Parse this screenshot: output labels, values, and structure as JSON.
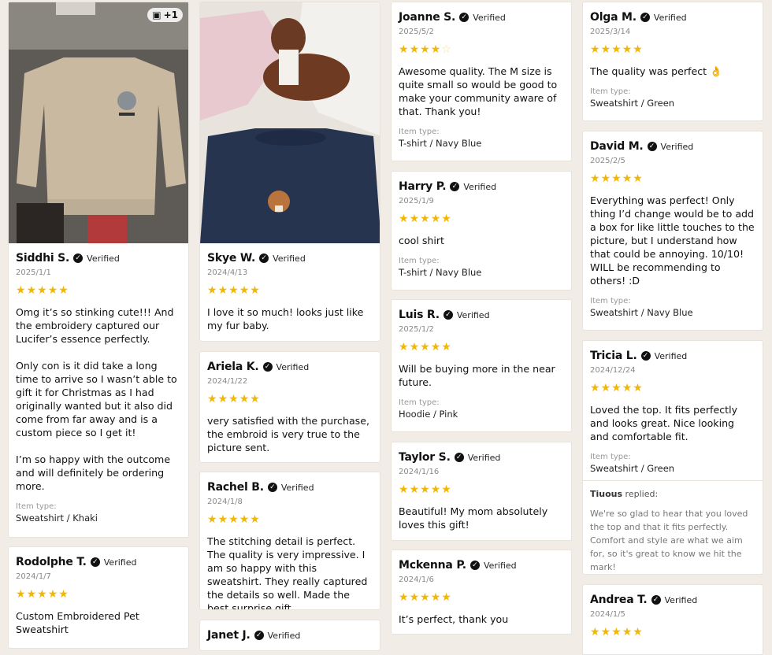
{
  "verified_label": "Verified",
  "item_type_label": "Item type:",
  "photo_badge": "+1",
  "col1": [
    {
      "name": "Siddhi S.",
      "date": "2025/1/1",
      "rating": 5,
      "text": "Omg it’s so stinking cute!!! And the embroidery captured our Lucifer’s essence perfectly.\n\nOnly con is it did take a long time to arrive so I wasn’t able to gift it for Christmas as I had originally wanted but it also did come from far away and is a custom piece so I get it!\n\nI’m so happy with the outcome and will definitely be ordering more.",
      "item": "Sweatshirt / Khaki"
    },
    {
      "name": "Rodolphe T.",
      "date": "2024/1/7",
      "rating": 5,
      "text": "Custom Embroidered Pet Sweatshirt"
    }
  ],
  "col2": [
    {
      "name": "Skye W.",
      "date": "2024/4/13",
      "rating": 5,
      "text": "I love it so much! looks just like my fur baby."
    },
    {
      "name": "Ariela K.",
      "date": "2024/1/22",
      "rating": 5,
      "text": "very satisfied with the purchase, the embroid is very true to the picture sent."
    },
    {
      "name": "Rachel B.",
      "date": "2024/1/8",
      "rating": 5,
      "text": "The stitching detail is perfect. The quality is very impressive. I am so happy with this sweatshirt. They really captured the details so well. Made the best surprise gift"
    },
    {
      "name": "Janet J."
    }
  ],
  "col3": [
    {
      "name": "Joanne S.",
      "date": "2025/5/2",
      "rating": 4,
      "text": "Awesome quality. The M size is quite small so would be good to make your community aware of that. Thank you!",
      "item": "T-shirt / Navy Blue"
    },
    {
      "name": "Harry P.",
      "date": "2025/1/9",
      "rating": 5,
      "text": "cool shirt",
      "item": "T-shirt / Navy Blue"
    },
    {
      "name": "Luis R.",
      "date": "2025/1/2",
      "rating": 5,
      "text": "Will be buying more in the near future.",
      "item": "Hoodie / Pink"
    },
    {
      "name": "Taylor S.",
      "date": "2024/1/16",
      "rating": 5,
      "text": "Beautiful! My mom absolutely loves this gift!"
    },
    {
      "name": "Mckenna P.",
      "date": "2024/1/6",
      "rating": 5,
      "text": "It’s perfect, thank you"
    }
  ],
  "col4": [
    {
      "name": "Olga M.",
      "date": "2025/3/14",
      "rating": 5,
      "text": "The quality was perfect 👌",
      "item": "Sweatshirt / Green"
    },
    {
      "name": "David M.",
      "date": "2025/2/5",
      "rating": 5,
      "text": "Everything was perfect! Only thing I’d change would be to add a box for like little touches to the picture, but I understand how that could be annoying. 10/10! WILL be recommending to others! :D",
      "item": "Sweatshirt / Navy Blue"
    },
    {
      "name": "Tricia L.",
      "date": "2024/12/24",
      "rating": 5,
      "text": "Loved the top. It fits perfectly and looks great. Nice looking and comfortable fit.",
      "item": "Sweatshirt / Green",
      "reply_author": "Tiuous",
      "reply_suffix": "replied:",
      "reply": "We're so glad to hear that you loved the top and that it fits perfectly. Comfort and style are what we aim for, so it's great to know we hit the mark!"
    },
    {
      "name": "Andrea T.",
      "date": "2024/1/5",
      "rating": 5
    }
  ]
}
